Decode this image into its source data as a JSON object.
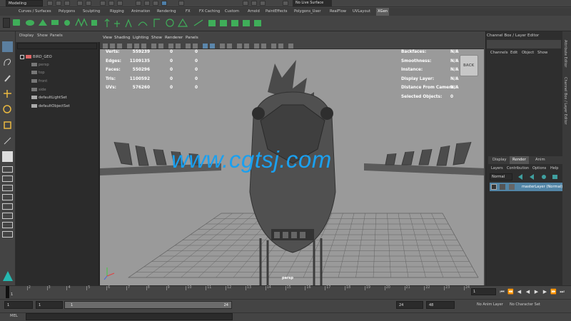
{
  "topbar": {
    "mode": "Modeling",
    "live_surface": "No Live Surface"
  },
  "shelf_tabs": [
    "Curves / Surfaces",
    "Polygons",
    "Sculpting",
    "Rigging",
    "Animation",
    "Rendering",
    "FX",
    "FX Caching",
    "Custom",
    "Arnold",
    "PaintEffects",
    "Polygons_User",
    "RealFlow",
    "UVLayout",
    "XGen"
  ],
  "shelf_active": "XGen",
  "outliner": {
    "menu": [
      "Display",
      "Show",
      "Panels"
    ],
    "items": [
      "BIRD_GEO",
      "persp",
      "top",
      "front",
      "side",
      "defaultLightSet",
      "defaultObjectSet"
    ]
  },
  "viewport": {
    "menu": [
      "View",
      "Shading",
      "Lighting",
      "Show",
      "Renderer",
      "Panels"
    ],
    "hud_left": [
      {
        "label": "Verts:",
        "v1": "559239",
        "v2": "0",
        "v3": "0"
      },
      {
        "label": "Edges:",
        "v1": "1109135",
        "v2": "0",
        "v3": "0"
      },
      {
        "label": "Faces:",
        "v1": "550296",
        "v2": "0",
        "v3": "0"
      },
      {
        "label": "Tris:",
        "v1": "1100592",
        "v2": "0",
        "v3": "0"
      },
      {
        "label": "UVs:",
        "v1": "576260",
        "v2": "0",
        "v3": "0"
      }
    ],
    "hud_right": [
      {
        "label": "Backfaces:",
        "value": "N/A"
      },
      {
        "label": "Smoothness:",
        "value": "N/A"
      },
      {
        "label": "Instance:",
        "value": "N/A"
      },
      {
        "label": "Display Layer:",
        "value": "N/A"
      },
      {
        "label": "Distance From Camera:",
        "value": "N/A"
      },
      {
        "label": "Selected Objects:",
        "value": "0"
      }
    ],
    "viewcube_label": "BACK",
    "camera": "persp",
    "watermark": "www.cgtsj.com"
  },
  "channelbox": {
    "title": "Channel Box / Layer Editor",
    "menu": [
      "Channels",
      "Edit",
      "Object",
      "Show"
    ],
    "side_tabs": [
      "Attribute Editor",
      "Channel Box / Layer Editor"
    ],
    "layer_tabs": [
      "Display",
      "Render",
      "Anim"
    ],
    "layer_tab_active": "Render",
    "layer_menu": [
      "Layers",
      "Contribution",
      "Options",
      "Help"
    ],
    "layer_mode": "Normal",
    "master_layer": "masterLayer (Normal)"
  },
  "timeslider": {
    "ticks": [
      "1",
      "2",
      "3",
      "4",
      "5",
      "6",
      "7",
      "8",
      "9",
      "10",
      "11",
      "12",
      "13",
      "14",
      "15",
      "16",
      "17",
      "18",
      "19",
      "20",
      "21",
      "22",
      "23",
      "24"
    ],
    "current_frame": "1",
    "current_field": "1"
  },
  "range": {
    "start": "1",
    "playback_start": "1",
    "slider_start": "1",
    "slider_end": "24",
    "playback_end": "24",
    "end": "48",
    "anim_layer": "No Anim Layer",
    "char_set": "No Character Set"
  },
  "cmdline": {
    "label": "MEL"
  },
  "colors": {
    "accent": "#5285a6",
    "watermark": "#1aa0f0",
    "viewport_bg": "#9a9a9a"
  }
}
